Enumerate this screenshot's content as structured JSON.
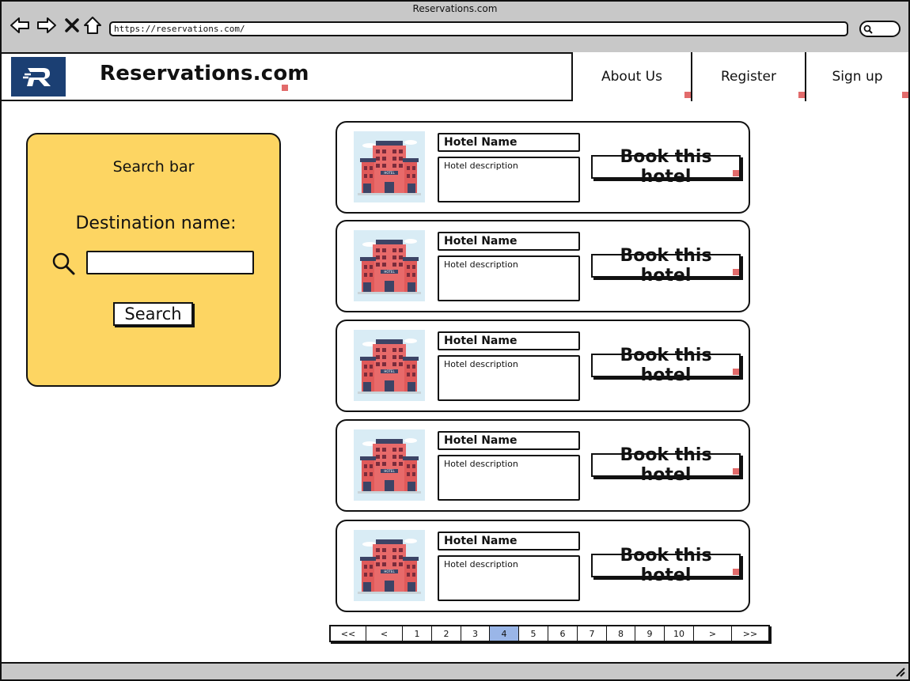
{
  "window": {
    "title": "Reservations.com"
  },
  "browser": {
    "url": "https://reservations.com/",
    "nav_icons": [
      "back-arrow-icon",
      "forward-arrow-icon",
      "close-icon",
      "home-icon"
    ]
  },
  "header": {
    "logo_letter": "R",
    "brand": "Reservations.com",
    "nav": [
      "About Us",
      "Register",
      "Sign up"
    ],
    "logo_color": "#1b3f73"
  },
  "search_panel": {
    "title": "Search bar",
    "destination_label": "Destination name:",
    "input_value": "",
    "search_label": "Search",
    "panel_color": "#fdd562"
  },
  "hotels": [
    {
      "name": "Hotel Name",
      "description": "Hotel description",
      "button": "Book this hotel",
      "image_caption": "HOTEL"
    },
    {
      "name": "Hotel Name",
      "description": "Hotel description",
      "button": "Book this hotel",
      "image_caption": "HOTEL"
    },
    {
      "name": "Hotel Name",
      "description": "Hotel description",
      "button": "Book this hotel",
      "image_caption": "HOTEL"
    },
    {
      "name": "Hotel Name",
      "description": "Hotel description",
      "button": "Book this hotel",
      "image_caption": "HOTEL"
    },
    {
      "name": "Hotel Name",
      "description": "Hotel description",
      "button": "Book this hotel",
      "image_caption": "HOTEL"
    }
  ],
  "pagination": {
    "items": [
      "<<",
      "<",
      "1",
      "2",
      "3",
      "4",
      "5",
      "6",
      "7",
      "8",
      "9",
      "10",
      ">",
      ">>"
    ],
    "current": "4",
    "active_color": "#9ab6e8"
  }
}
